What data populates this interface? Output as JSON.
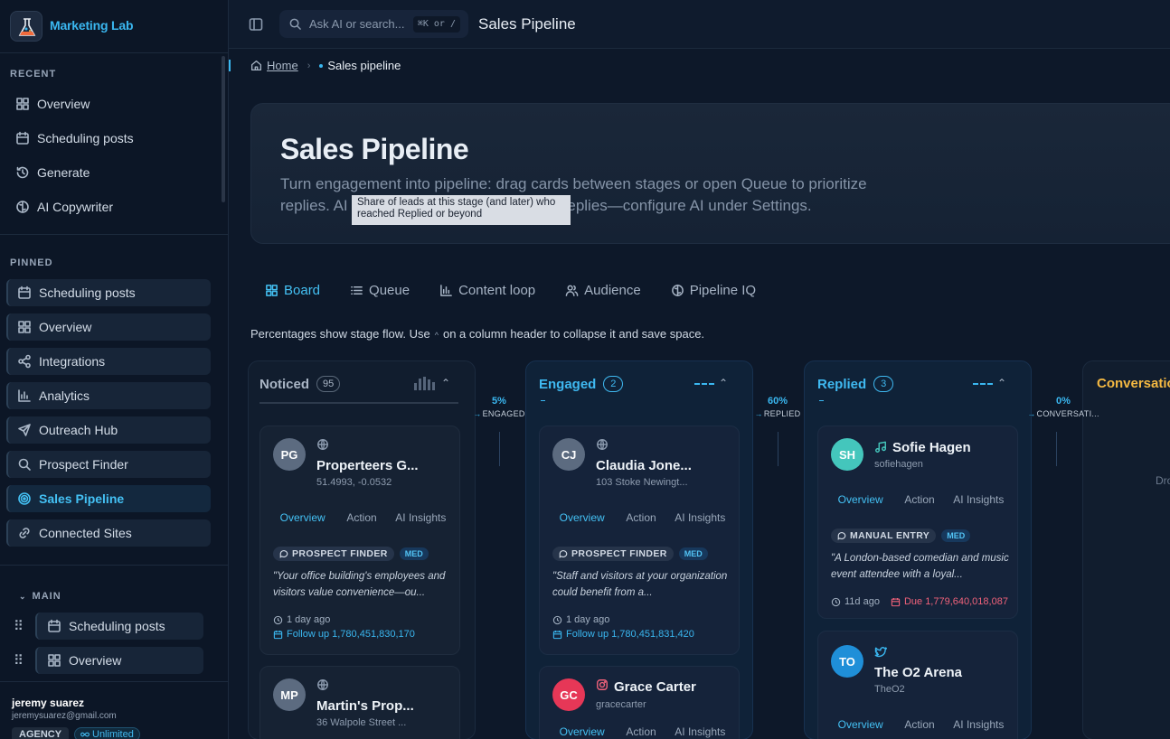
{
  "brand": {
    "name": "Marketing Lab"
  },
  "sidebar": {
    "recent_label": "RECENT",
    "recent": [
      {
        "label": "Overview",
        "icon": "grid-icon"
      },
      {
        "label": "Scheduling posts",
        "icon": "calendar-icon"
      },
      {
        "label": "Generate",
        "icon": "history-icon"
      },
      {
        "label": "AI Copywriter",
        "icon": "brain-icon"
      }
    ],
    "pinned_label": "PINNED",
    "pinned": [
      {
        "label": "Scheduling posts"
      },
      {
        "label": "Overview"
      },
      {
        "label": "Integrations"
      },
      {
        "label": "Analytics"
      },
      {
        "label": "Outreach Hub"
      },
      {
        "label": "Prospect Finder"
      },
      {
        "label": "Sales Pipeline",
        "active": true
      },
      {
        "label": "Connected Sites"
      }
    ],
    "main_label": "MAIN",
    "main": [
      {
        "label": "Scheduling posts"
      },
      {
        "label": "Overview"
      }
    ]
  },
  "user": {
    "name": "jeremy suarez",
    "email": "jeremysuarez@gmail.com",
    "plan": "AGENCY",
    "quota": "Unlimited"
  },
  "topbar": {
    "search_placeholder": "Ask AI or search...",
    "shortcut": "⌘K or /",
    "title": "Sales Pipeline"
  },
  "breadcrumb": {
    "home": "Home",
    "current": "Sales pipeline"
  },
  "hero": {
    "title": "Sales Pipeline",
    "description_1": "Turn engagement into pipeline: drag cards between stages or open Queue to prioritize",
    "description_2a": "replies. AI ",
    "description_2b": "eplies—configure AI under Settings."
  },
  "tooltip": "Share of leads at this stage (and later) who reached Replied or beyond",
  "tabs": [
    {
      "label": "Board",
      "active": true
    },
    {
      "label": "Queue"
    },
    {
      "label": "Content loop"
    },
    {
      "label": "Audience"
    },
    {
      "label": "Pipeline IQ"
    }
  ],
  "hint": {
    "before": "Percentages show stage flow. Use",
    "caret": "^",
    "after": "on a column header to collapse it and save space."
  },
  "flows": [
    {
      "pct": "5%",
      "label": "ENGAGED"
    },
    {
      "pct": "60%",
      "label": "REPLIED"
    },
    {
      "pct": "0%",
      "label": "CONVERSATI..."
    }
  ],
  "columns": {
    "noticed": {
      "title": "Noticed",
      "count": "95"
    },
    "engaged": {
      "title": "Engaged",
      "count": "2"
    },
    "replied": {
      "title": "Replied",
      "count": "3"
    },
    "conversation": {
      "title": "Conversatio",
      "drop": "Dro"
    }
  },
  "card_tabs": {
    "overview": "Overview",
    "action": "Action",
    "ai": "AI Insights"
  },
  "cards": {
    "pg": {
      "initials": "PG",
      "name": "Properteers G...",
      "sub": "51.4993, -0.0532",
      "source": "PROSPECT FINDER",
      "priority": "MED",
      "quote": "\"Your office building's employees and visitors value convenience—ou...",
      "age": "1 day ago",
      "followup": "Follow up 1,780,451,830,170"
    },
    "mp": {
      "initials": "MP",
      "name": "Martin's Prop...",
      "sub": "36 Walpole Street ..."
    },
    "cj": {
      "initials": "CJ",
      "name": "Claudia Jone...",
      "sub": "103 Stoke Newingt...",
      "source": "PROSPECT FINDER",
      "priority": "MED",
      "quote": "\"Staff and visitors at your organization could benefit from a...",
      "age": "1 day ago",
      "followup": "Follow up 1,780,451,831,420"
    },
    "gc": {
      "initials": "GC",
      "name": "Grace Carter",
      "sub": "gracecarter"
    },
    "sh": {
      "initials": "SH",
      "name": "Sofie Hagen",
      "sub": "sofiehagen",
      "source": "MANUAL ENTRY",
      "priority": "MED",
      "quote": "\"A London-based comedian and music event attendee with a loyal...",
      "age": "11d ago",
      "due": "Due 1,779,640,018,087"
    },
    "to": {
      "initials": "TO",
      "name": "The O2 Arena",
      "sub": "TheO2"
    }
  },
  "colors": {
    "accent": "#3ab7f0",
    "bg": "#0d1829",
    "due": "#f0627a"
  }
}
